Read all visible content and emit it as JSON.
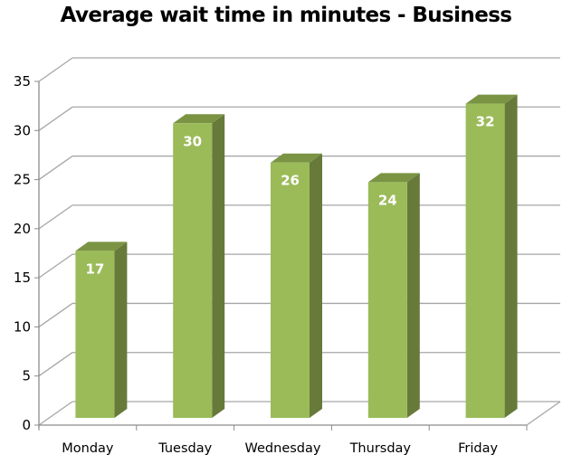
{
  "chart_data": {
    "type": "bar",
    "style": "3d-clustered-column",
    "title": "Average wait time in minutes - Business",
    "xlabel": "",
    "ylabel": "",
    "categories": [
      "Monday",
      "Tuesday",
      "Wednesday",
      "Thursday",
      "Friday"
    ],
    "values": [
      17,
      30,
      26,
      24,
      32
    ],
    "data_labels": [
      "17",
      "30",
      "26",
      "24",
      "32"
    ],
    "ylim": [
      0,
      35
    ],
    "yticks": [
      0,
      5,
      10,
      15,
      20,
      25,
      30,
      35
    ],
    "ytick_labels": [
      "0",
      "5",
      "10",
      "15",
      "20",
      "25",
      "30",
      "35"
    ],
    "grid": true,
    "legend": "none",
    "colors": {
      "bar_front": "#9bbb59",
      "bar_side": "#677a3a",
      "bar_top": "#7a9444",
      "grid": "#a6a6a6",
      "axis": "#8c8c8c",
      "data_label": "#ffffff"
    }
  }
}
